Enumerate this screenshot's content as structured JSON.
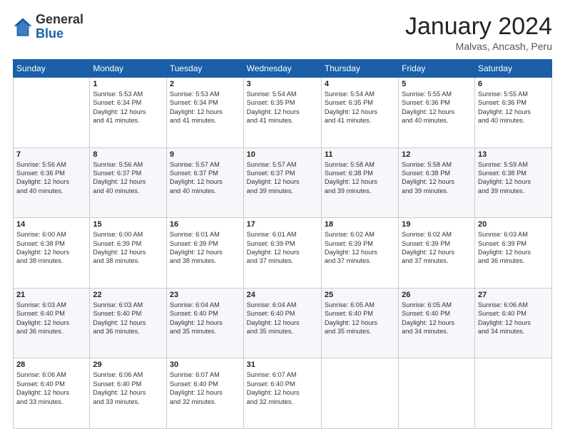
{
  "header": {
    "logo_general": "General",
    "logo_blue": "Blue",
    "month_title": "January 2024",
    "location": "Malvas, Ancash, Peru"
  },
  "days_of_week": [
    "Sunday",
    "Monday",
    "Tuesday",
    "Wednesday",
    "Thursday",
    "Friday",
    "Saturday"
  ],
  "weeks": [
    [
      {
        "day": "",
        "info": ""
      },
      {
        "day": "1",
        "info": "Sunrise: 5:53 AM\nSunset: 6:34 PM\nDaylight: 12 hours\nand 41 minutes."
      },
      {
        "day": "2",
        "info": "Sunrise: 5:53 AM\nSunset: 6:34 PM\nDaylight: 12 hours\nand 41 minutes."
      },
      {
        "day": "3",
        "info": "Sunrise: 5:54 AM\nSunset: 6:35 PM\nDaylight: 12 hours\nand 41 minutes."
      },
      {
        "day": "4",
        "info": "Sunrise: 5:54 AM\nSunset: 6:35 PM\nDaylight: 12 hours\nand 41 minutes."
      },
      {
        "day": "5",
        "info": "Sunrise: 5:55 AM\nSunset: 6:36 PM\nDaylight: 12 hours\nand 40 minutes."
      },
      {
        "day": "6",
        "info": "Sunrise: 5:55 AM\nSunset: 6:36 PM\nDaylight: 12 hours\nand 40 minutes."
      }
    ],
    [
      {
        "day": "7",
        "info": "Sunrise: 5:56 AM\nSunset: 6:36 PM\nDaylight: 12 hours\nand 40 minutes."
      },
      {
        "day": "8",
        "info": "Sunrise: 5:56 AM\nSunset: 6:37 PM\nDaylight: 12 hours\nand 40 minutes."
      },
      {
        "day": "9",
        "info": "Sunrise: 5:57 AM\nSunset: 6:37 PM\nDaylight: 12 hours\nand 40 minutes."
      },
      {
        "day": "10",
        "info": "Sunrise: 5:57 AM\nSunset: 6:37 PM\nDaylight: 12 hours\nand 39 minutes."
      },
      {
        "day": "11",
        "info": "Sunrise: 5:58 AM\nSunset: 6:38 PM\nDaylight: 12 hours\nand 39 minutes."
      },
      {
        "day": "12",
        "info": "Sunrise: 5:58 AM\nSunset: 6:38 PM\nDaylight: 12 hours\nand 39 minutes."
      },
      {
        "day": "13",
        "info": "Sunrise: 5:59 AM\nSunset: 6:38 PM\nDaylight: 12 hours\nand 39 minutes."
      }
    ],
    [
      {
        "day": "14",
        "info": "Sunrise: 6:00 AM\nSunset: 6:38 PM\nDaylight: 12 hours\nand 38 minutes."
      },
      {
        "day": "15",
        "info": "Sunrise: 6:00 AM\nSunset: 6:39 PM\nDaylight: 12 hours\nand 38 minutes."
      },
      {
        "day": "16",
        "info": "Sunrise: 6:01 AM\nSunset: 6:39 PM\nDaylight: 12 hours\nand 38 minutes."
      },
      {
        "day": "17",
        "info": "Sunrise: 6:01 AM\nSunset: 6:39 PM\nDaylight: 12 hours\nand 37 minutes."
      },
      {
        "day": "18",
        "info": "Sunrise: 6:02 AM\nSunset: 6:39 PM\nDaylight: 12 hours\nand 37 minutes."
      },
      {
        "day": "19",
        "info": "Sunrise: 6:02 AM\nSunset: 6:39 PM\nDaylight: 12 hours\nand 37 minutes."
      },
      {
        "day": "20",
        "info": "Sunrise: 6:03 AM\nSunset: 6:39 PM\nDaylight: 12 hours\nand 36 minutes."
      }
    ],
    [
      {
        "day": "21",
        "info": "Sunrise: 6:03 AM\nSunset: 6:40 PM\nDaylight: 12 hours\nand 36 minutes."
      },
      {
        "day": "22",
        "info": "Sunrise: 6:03 AM\nSunset: 6:40 PM\nDaylight: 12 hours\nand 36 minutes."
      },
      {
        "day": "23",
        "info": "Sunrise: 6:04 AM\nSunset: 6:40 PM\nDaylight: 12 hours\nand 35 minutes."
      },
      {
        "day": "24",
        "info": "Sunrise: 6:04 AM\nSunset: 6:40 PM\nDaylight: 12 hours\nand 35 minutes."
      },
      {
        "day": "25",
        "info": "Sunrise: 6:05 AM\nSunset: 6:40 PM\nDaylight: 12 hours\nand 35 minutes."
      },
      {
        "day": "26",
        "info": "Sunrise: 6:05 AM\nSunset: 6:40 PM\nDaylight: 12 hours\nand 34 minutes."
      },
      {
        "day": "27",
        "info": "Sunrise: 6:06 AM\nSunset: 6:40 PM\nDaylight: 12 hours\nand 34 minutes."
      }
    ],
    [
      {
        "day": "28",
        "info": "Sunrise: 6:06 AM\nSunset: 6:40 PM\nDaylight: 12 hours\nand 33 minutes."
      },
      {
        "day": "29",
        "info": "Sunrise: 6:06 AM\nSunset: 6:40 PM\nDaylight: 12 hours\nand 33 minutes."
      },
      {
        "day": "30",
        "info": "Sunrise: 6:07 AM\nSunset: 6:40 PM\nDaylight: 12 hours\nand 32 minutes."
      },
      {
        "day": "31",
        "info": "Sunrise: 6:07 AM\nSunset: 6:40 PM\nDaylight: 12 hours\nand 32 minutes."
      },
      {
        "day": "",
        "info": ""
      },
      {
        "day": "",
        "info": ""
      },
      {
        "day": "",
        "info": ""
      }
    ]
  ]
}
